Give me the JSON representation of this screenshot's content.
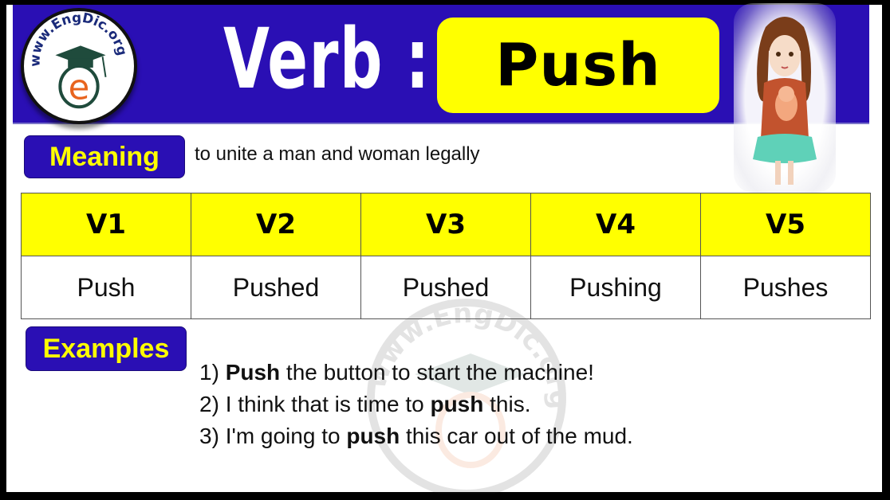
{
  "logo": {
    "text": "www.EngDic.org",
    "letter": "e",
    "colors": {
      "ring_text": "#1a2a7a",
      "cap": "#1f4b3c",
      "letter": "#e8641e"
    }
  },
  "header": {
    "title": "Verb :",
    "word": "Push",
    "background": "#2a0fb4",
    "word_box_color": "#ffff00"
  },
  "meaning": {
    "label": "Meaning",
    "text": "to unite a man and woman legally"
  },
  "forms_table": {
    "headers": [
      "V1",
      "V2",
      "V3",
      "V4",
      "V5"
    ],
    "values": [
      "Push",
      "Pushed",
      "Pushed",
      "Pushing",
      "Pushes"
    ],
    "header_color": "#ffff00"
  },
  "examples": {
    "label": "Examples",
    "items": [
      {
        "number": "1)",
        "before": "",
        "bold": "Push",
        "after": " the button to start the machine!"
      },
      {
        "number": "2)",
        "before": "I think that is time to ",
        "bold": "push",
        "after": " this."
      },
      {
        "number": "3)",
        "before": "I'm going to ",
        "bold": "push",
        "after": " this car out of the mud."
      }
    ]
  },
  "illustration": {
    "subject": "girl-holding-cat",
    "colors": {
      "hair": "#7a3d1a",
      "dress": "#c2532e",
      "skirt": "#5fd1b8",
      "cat": "#f3a77e"
    }
  },
  "watermark": {
    "text": "www.EngDic.org"
  }
}
